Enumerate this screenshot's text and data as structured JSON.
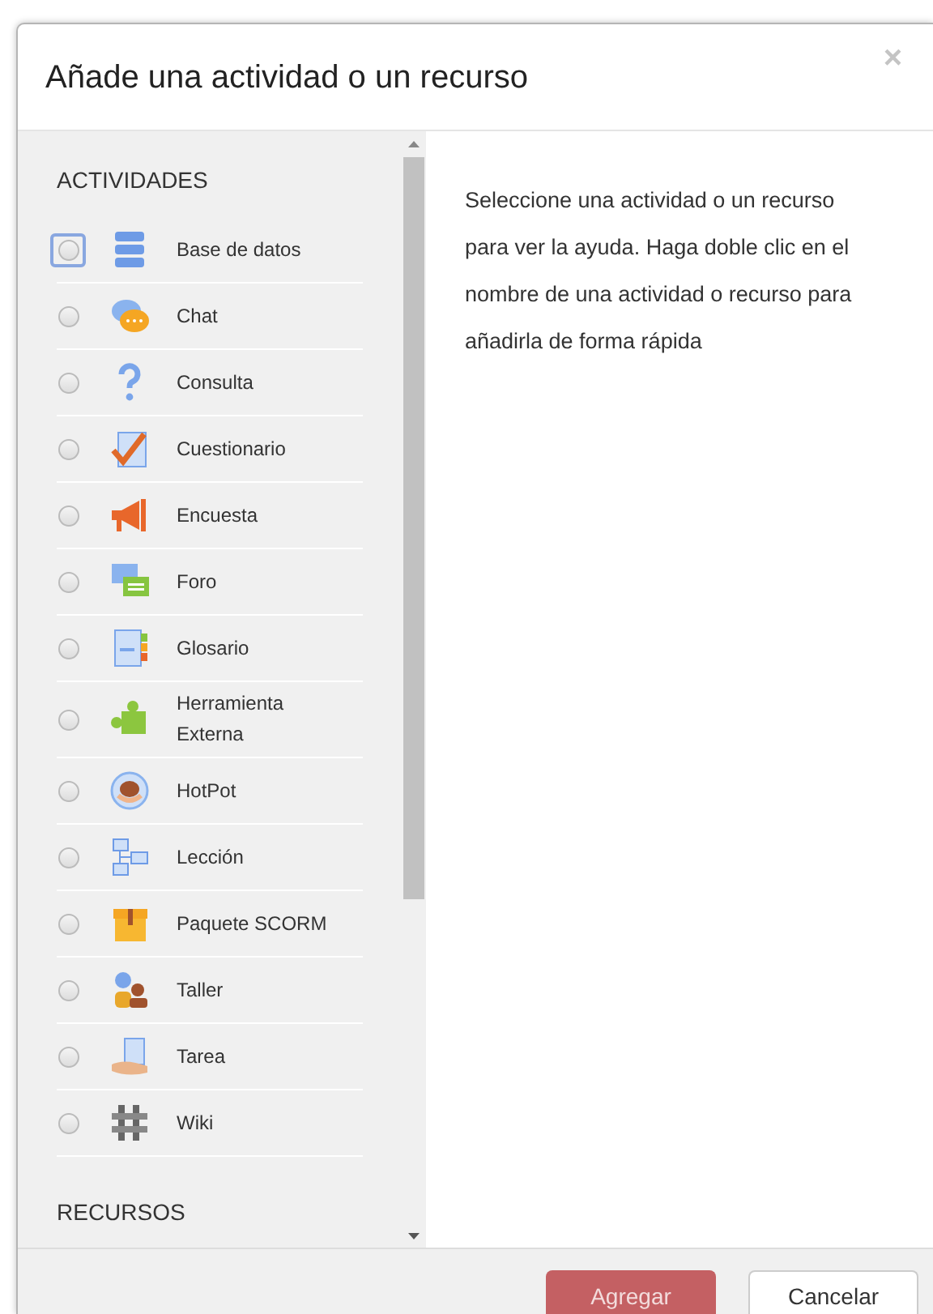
{
  "dialog": {
    "title": "Añade una actividad o un recurso",
    "close": "×"
  },
  "sections": [
    {
      "heading": "ACTIVIDADES",
      "items": [
        {
          "label": "Base de datos",
          "selected": false,
          "focused": true
        },
        {
          "label": "Chat",
          "selected": false,
          "focused": false
        },
        {
          "label": "Consulta",
          "selected": false,
          "focused": false
        },
        {
          "label": "Cuestionario",
          "selected": false,
          "focused": false
        },
        {
          "label": "Encuesta",
          "selected": false,
          "focused": false
        },
        {
          "label": "Foro",
          "selected": false,
          "focused": false
        },
        {
          "label": "Glosario",
          "selected": false,
          "focused": false
        },
        {
          "label": "Herramienta Externa",
          "selected": false,
          "focused": false
        },
        {
          "label": "HotPot",
          "selected": false,
          "focused": false
        },
        {
          "label": "Lección",
          "selected": false,
          "focused": false
        },
        {
          "label": "Paquete SCORM",
          "selected": false,
          "focused": false
        },
        {
          "label": "Taller",
          "selected": false,
          "focused": false
        },
        {
          "label": "Tarea",
          "selected": false,
          "focused": false
        },
        {
          "label": "Wiki",
          "selected": false,
          "focused": false
        }
      ]
    },
    {
      "heading": "RECURSOS"
    }
  ],
  "help_text": "Seleccione una actividad o un recurso para ver la ayuda. Haga doble clic en el nombre de una actividad o recurso para añadirla de forma rápida",
  "buttons": [
    {
      "label": "Agregar",
      "kind": "primary"
    },
    {
      "label": "Cancelar",
      "kind": "secondary"
    }
  ]
}
